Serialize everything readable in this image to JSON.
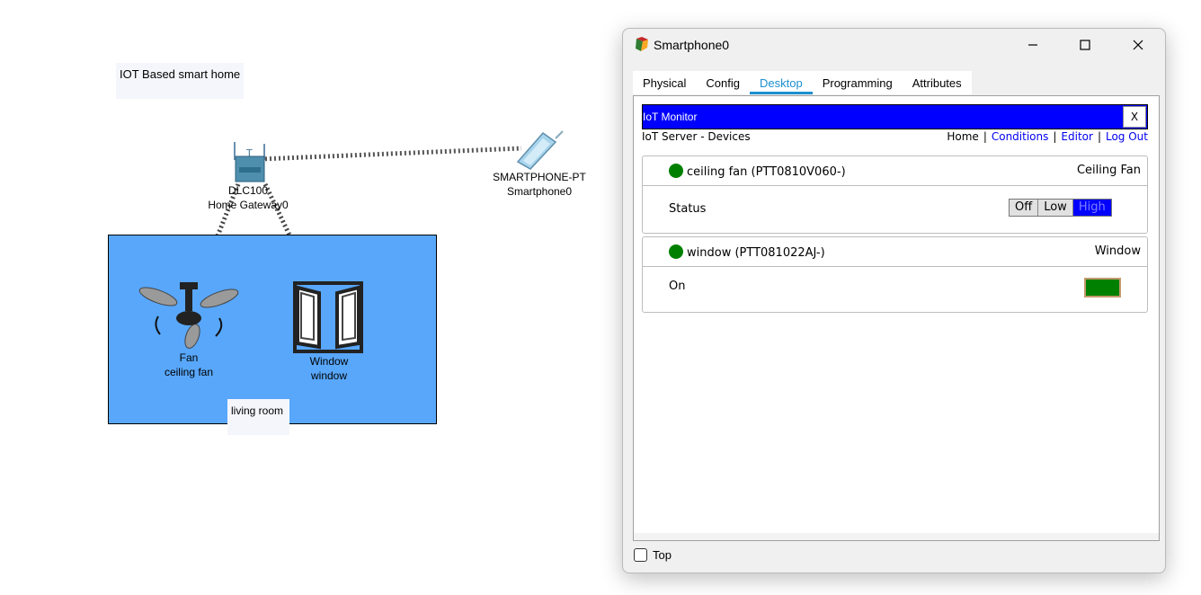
{
  "workspace": {
    "title_note": "IOT Based smart home",
    "room_note": "living room",
    "gateway": {
      "model": "DLC100",
      "name": "Home Gateway0"
    },
    "smartphone": {
      "model": "SMARTPHONE-PT",
      "name": "Smartphone0"
    },
    "fan": {
      "model": "Fan",
      "name": "ceiling fan"
    },
    "window_device": {
      "model": "Window",
      "name": "window"
    },
    "room_color": "#58a7fb"
  },
  "window": {
    "title": "Smartphone0",
    "tabs": [
      {
        "label": "Physical"
      },
      {
        "label": "Config"
      },
      {
        "label": "Desktop"
      },
      {
        "label": "Programming"
      },
      {
        "label": "Attributes"
      }
    ],
    "active_tab": "Desktop",
    "top_checkbox_label": "Top"
  },
  "iot": {
    "title": "IoT Monitor",
    "close_label": "X",
    "server_label": "IoT Server - Devices",
    "nav": {
      "home": "Home",
      "conditions": "Conditions",
      "editor": "Editor",
      "logout": "Log Out"
    },
    "devices": [
      {
        "name": "ceiling fan (PTT0810V060-)",
        "type": "Ceiling Fan",
        "status_color": "#008000",
        "property": "Status",
        "options": [
          "Off",
          "Low",
          "High"
        ],
        "selected": "High"
      },
      {
        "name": "window (PTT081022AJ-)",
        "type": "Window",
        "status_color": "#008000",
        "property": "On",
        "value_color": "#008000"
      }
    ]
  }
}
